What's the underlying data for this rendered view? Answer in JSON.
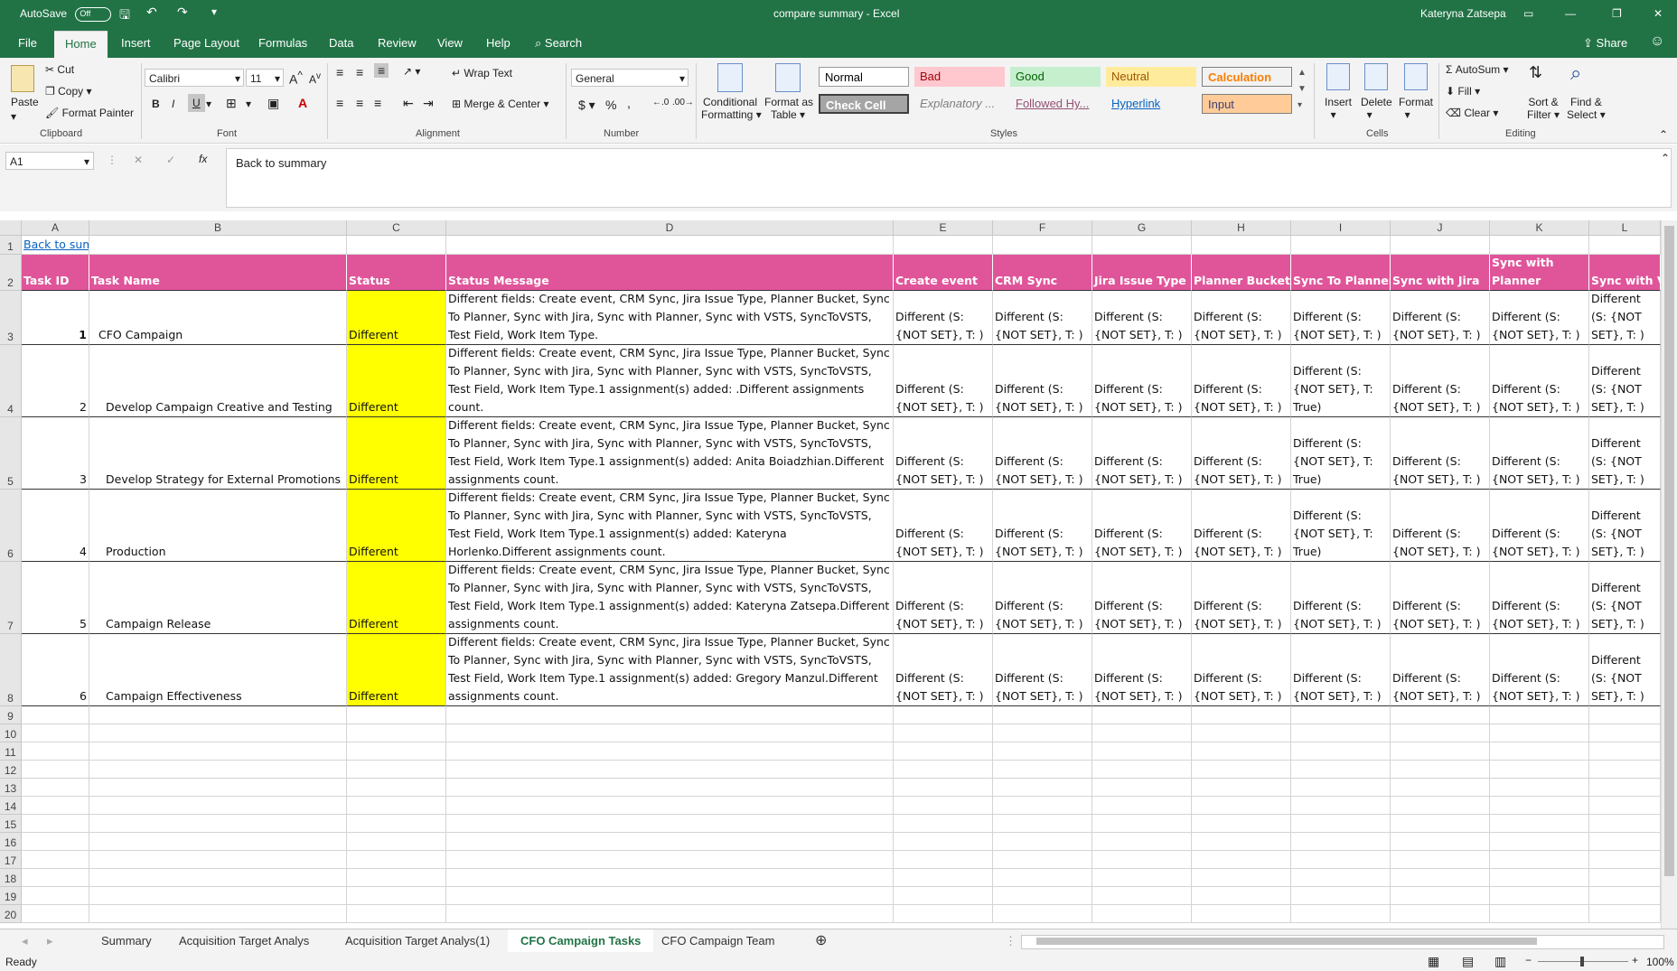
{
  "titlebar": {
    "autosave": "AutoSave",
    "autosave_state": "Off",
    "doc_title": "compare summary  -  Excel",
    "user": "Kateryna Zatsepa"
  },
  "ribbon_tabs": [
    "File",
    "Home",
    "Insert",
    "Page Layout",
    "Formulas",
    "Data",
    "Review",
    "View",
    "Help"
  ],
  "search": "Search",
  "share": "Share",
  "ribbon": {
    "clipboard": {
      "paste": "Paste",
      "cut": "Cut",
      "copy": "Copy",
      "format_painter": "Format Painter",
      "label": "Clipboard"
    },
    "font": {
      "name": "Calibri",
      "size": "11",
      "bold": "B",
      "italic": "I",
      "underline": "U",
      "grow": "A",
      "shrink": "A",
      "label": "Font"
    },
    "alignment": {
      "wrap": "Wrap Text",
      "merge": "Merge & Center",
      "label": "Alignment"
    },
    "number": {
      "format": "General",
      "currency": "$",
      "percent": "%",
      "comma": ",",
      "label": "Number"
    },
    "styles": {
      "conditional": "Conditional",
      "conditional2": "Formatting",
      "format_as": "Format as",
      "format_as2": "Table",
      "normal": "Normal",
      "bad": "Bad",
      "good": "Good",
      "neutral": "Neutral",
      "calculation": "Calculation",
      "check_cell": "Check Cell",
      "explanatory": "Explanatory ...",
      "followed": "Followed Hy...",
      "hyperlink": "Hyperlink",
      "input": "Input",
      "label": "Styles"
    },
    "cells": {
      "insert": "Insert",
      "delete": "Delete",
      "format": "Format",
      "label": "Cells"
    },
    "editing": {
      "autosum": "AutoSum",
      "fill": "Fill",
      "clear": "Clear",
      "sort": "Sort &",
      "sort2": "Filter",
      "find": "Find &",
      "find2": "Select",
      "label": "Editing"
    }
  },
  "formula_bar": {
    "name_box": "A1",
    "fx": "fx",
    "content": "Back to summary"
  },
  "columns": [
    "A",
    "B",
    "C",
    "D",
    "E",
    "F",
    "G",
    "H",
    "I",
    "J",
    "K",
    "L"
  ],
  "row_numbers": [
    "1",
    "2",
    "3",
    "4",
    "5",
    "6",
    "7",
    "8",
    "9",
    "10",
    "11",
    "12",
    "13",
    "14",
    "15",
    "16",
    "17",
    "18",
    "19",
    "20"
  ],
  "link_cell": "Back to summary",
  "headers": [
    "Task ID",
    "Task Name",
    "Status",
    "Status Message",
    "Create event",
    "CRM Sync",
    "Jira Issue Type",
    "Planner Bucket",
    "Sync To Planner",
    "Sync with Jira",
    "Sync with Planner",
    "Sync with VSTS"
  ],
  "k_header_line1": "Sync with",
  "k_header_line2": "Planner",
  "rows": [
    {
      "id": "1",
      "name": "CFO Campaign",
      "status": "Different",
      "msg": "Different fields: Create event, CRM Sync, Jira Issue Type, Planner Bucket, Sync To Planner, Sync with Jira, Sync with Planner, Sync with VSTS, SyncToVSTS, Test Field, Work Item Type.",
      "i_val": "Different (S: {NOT SET}, T: )"
    },
    {
      "id": "2",
      "name": "Develop Campaign Creative and Testing",
      "status": "Different",
      "msg": "Different fields: Create event, CRM Sync, Jira Issue Type, Planner Bucket, Sync To Planner, Sync with Jira, Sync with Planner, Sync with VSTS, SyncToVSTS, Test Field, Work Item Type.1 assignment(s) added: .Different assignments count.",
      "i_val": "Different (S: {NOT SET}, T: True)"
    },
    {
      "id": "3",
      "name": "Develop Strategy for External Promotions",
      "status": "Different",
      "msg": "Different fields: Create event, CRM Sync, Jira Issue Type, Planner Bucket, Sync To Planner, Sync with Jira, Sync with Planner, Sync with VSTS, SyncToVSTS, Test Field, Work Item Type.1 assignment(s) added: Anita Boiadzhian.Different assignments count.",
      "i_val": "Different (S: {NOT SET}, T: True)"
    },
    {
      "id": "4",
      "name": "Production",
      "status": "Different",
      "msg": "Different fields: Create event, CRM Sync, Jira Issue Type, Planner Bucket, Sync To Planner, Sync with Jira, Sync with Planner, Sync with VSTS, SyncToVSTS, Test Field, Work Item Type.1 assignment(s) added: Kateryna Horlenko.Different assignments count.",
      "i_val": "Different (S: {NOT SET}, T: True)"
    },
    {
      "id": "5",
      "name": "Campaign Release",
      "status": "Different",
      "msg": "Different fields: Create event, CRM Sync, Jira Issue Type, Planner Bucket, Sync To Planner, Sync with Jira, Sync with Planner, Sync with VSTS, SyncToVSTS, Test Field, Work Item Type.1 assignment(s) added: Kateryna Zatsepa.Different assignments count.",
      "i_val": "Different (S: {NOT SET}, T: )"
    },
    {
      "id": "6",
      "name": "Campaign Effectiveness",
      "status": "Different",
      "msg": "Different fields: Create event, CRM Sync, Jira Issue Type, Planner Bucket, Sync To Planner, Sync with Jira, Sync with Planner, Sync with VSTS, SyncToVSTS, Test Field, Work Item Type.1 assignment(s) added: Gregory Manzul.Different assignments count.",
      "i_val": "Different (S: {NOT SET}, T: )"
    }
  ],
  "diff_value": "Different (S: {NOT SET}, T: )",
  "sheet_tabs": [
    "Summary",
    "Acquisition Target Analys",
    "Acquisition Target Analys(1)",
    "CFO Campaign Tasks",
    "CFO Campaign Team"
  ],
  "active_sheet": "CFO Campaign Tasks",
  "status_text": "Ready",
  "zoom": "100%",
  "colors": {
    "excel_green": "#217346",
    "header_pink": "#e0559a",
    "status_yellow": "#ffff00"
  }
}
